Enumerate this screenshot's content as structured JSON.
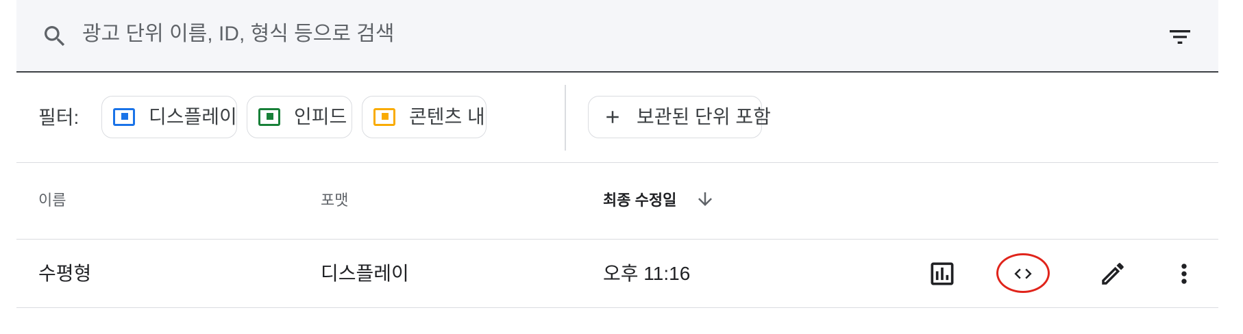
{
  "search": {
    "placeholder": "광고 단위 이름, ID, 형식 등으로 검색"
  },
  "filters": {
    "label": "필터:",
    "chips": [
      {
        "label": "디스플레이",
        "color": "#1a73e8"
      },
      {
        "label": "인피드",
        "color": "#188038"
      },
      {
        "label": "콘텐츠 내",
        "color": "#f9ab00"
      }
    ],
    "archived_chip": {
      "label": "보관된 단위 포함"
    }
  },
  "table": {
    "columns": {
      "name": "이름",
      "format": "포맷",
      "modified": "최종 수정일"
    },
    "rows": [
      {
        "name": "수평형",
        "format": "디스플레이",
        "modified": "오후 11:16"
      }
    ]
  },
  "icons": {
    "search": "search-icon",
    "filter_list": "filter-list-icon",
    "sort": "arrow-downward-icon",
    "report": "bar-chart-icon",
    "code": "code-icon",
    "edit": "pencil-icon",
    "more": "more-vert-icon"
  },
  "colors": {
    "highlight": "#e0241b"
  }
}
